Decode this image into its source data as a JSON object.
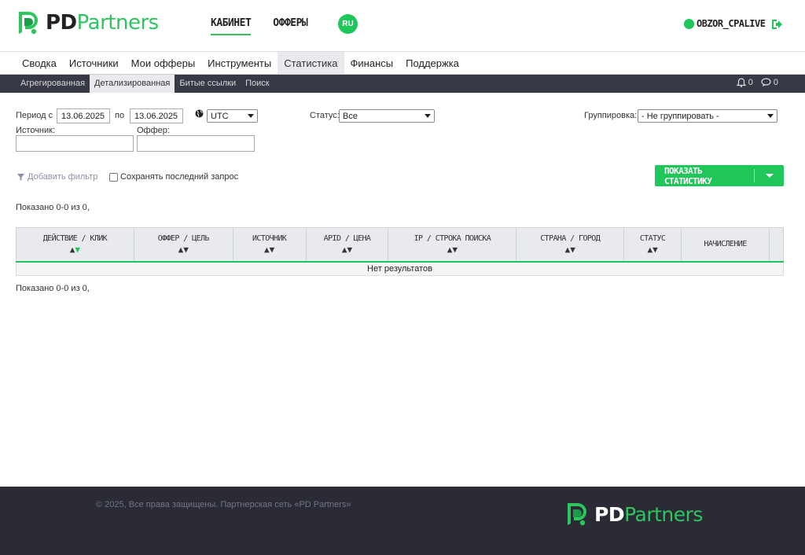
{
  "header": {
    "logo_bold": "PD",
    "logo_light": "Partners",
    "nav": [
      "КАБИНЕТ",
      "ОФФЕРЫ"
    ],
    "lang": "RU",
    "username": "OBZOR_CPALIVE"
  },
  "main_nav": [
    "Сводка",
    "Источники",
    "Мои офферы",
    "Инструменты",
    "Статистика",
    "Финансы",
    "Поддержка"
  ],
  "sub_nav": [
    "Агрегированная",
    "Детализированная",
    "Битые ссылки",
    "Поиск"
  ],
  "notifications": {
    "bell_count": "0",
    "messages_count": "0"
  },
  "filters": {
    "period_label": "Период с",
    "date_from": "13.06.2025",
    "to_label": "по",
    "date_to": "13.06.2025",
    "timezone": "UTC",
    "status_label": "Статус:",
    "status_value": "Все",
    "grouping_label": "Группировка:",
    "grouping_value": "- Не группировать -",
    "source_label": "Источник:",
    "offer_label": "Оффер:",
    "add_filter": "Добавить фильтр",
    "save_last": "Сохранять последний запрос",
    "show_button": "ПОКАЗАТЬ СТАТИСТИКУ"
  },
  "shown_text": "Показано 0-0 из 0,",
  "table": {
    "columns": [
      {
        "label": "ДЕЙСТВИЕ / КЛИК",
        "sort": true
      },
      {
        "label": "ОФФЕР / ЦЕЛЬ",
        "sort": true
      },
      {
        "label": "ИСТОЧНИК",
        "sort": true
      },
      {
        "label": "APID / ЦЕНА",
        "sort": true
      },
      {
        "label": "IP / СТРОКА ПОИСКА",
        "sort": true
      },
      {
        "label": "СТРАНА / ГОРОД",
        "sort": true
      },
      {
        "label": "СТАТУС",
        "sort": true
      },
      {
        "label": "НАЧИСЛЕНИЕ",
        "sort": false
      }
    ],
    "empty_text": "Нет результатов"
  },
  "footer": {
    "copyright": "© 2025, Все права защищены. Партнерская сеть «PD Partners»",
    "logo_bold": "PD",
    "logo_light": "Partners"
  }
}
